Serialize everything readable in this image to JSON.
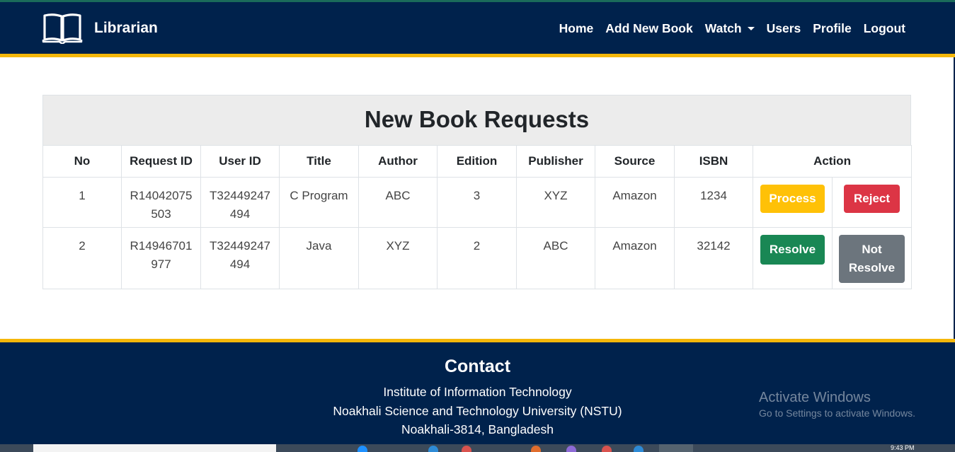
{
  "navbar": {
    "brand": "Librarian",
    "links": [
      "Home",
      "Add New Book",
      "Watch",
      "Users",
      "Profile",
      "Logout"
    ]
  },
  "card": {
    "title": "New Book Requests",
    "columns": [
      "No",
      "Request ID",
      "User ID",
      "Title",
      "Author",
      "Edition",
      "Publisher",
      "Source",
      "ISBN",
      "Action"
    ],
    "rows": [
      {
        "no": "1",
        "request_id": "R14042075503",
        "user_id": "T32449247494",
        "title": "C Program",
        "author": "ABC",
        "edition": "3",
        "publisher": "XYZ",
        "source": "Amazon",
        "isbn": "1234",
        "actions": [
          "Process",
          "Reject"
        ]
      },
      {
        "no": "2",
        "request_id": "R14946701977",
        "user_id": "T32449247494",
        "title": "Java",
        "author": "XYZ",
        "edition": "2",
        "publisher": "ABC",
        "source": "Amazon",
        "isbn": "32142",
        "actions": [
          "Resolve",
          "Not Resolve"
        ]
      }
    ]
  },
  "footer": {
    "title": "Contact",
    "lines": [
      "Institute of Information Technology",
      "Noakhali Science and Technology University (NSTU)",
      "Noakhali-3814, Bangladesh"
    ]
  },
  "watermark": {
    "title": "Activate Windows",
    "subtitle": "Go to Settings to activate Windows."
  },
  "taskbar": {
    "time": "9:43 PM"
  },
  "colors": {
    "navbar": "#00224c",
    "accent_border": "#f5b70a",
    "process": "#ffc107",
    "reject": "#dc3545",
    "resolve": "#198754",
    "not_resolve": "#6c757d"
  },
  "icons": {
    "brand": "open-book-icon",
    "watch_dropdown": "caret-down-icon"
  }
}
